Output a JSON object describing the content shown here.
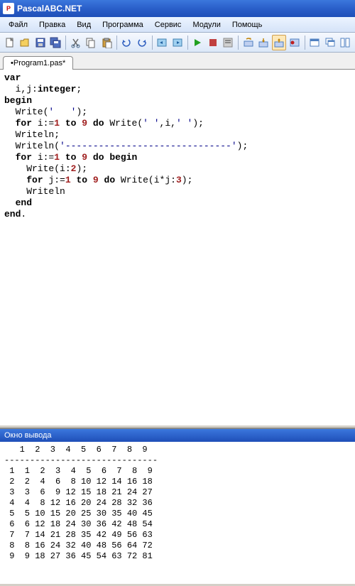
{
  "title": "PascalABC.NET",
  "menu": [
    "Файл",
    "Правка",
    "Вид",
    "Программа",
    "Сервис",
    "Модули",
    "Помощь"
  ],
  "tab": "•Program1.pas*",
  "output_title": "Окно вывода",
  "code": {
    "l1": "var",
    "l2_a": "  i,j:",
    "l2_b": "integer",
    "l2_c": ";",
    "l3": "begin",
    "l4_a": "  Write(",
    "l4_b": "'   '",
    "l4_c": ");",
    "l5_a": "  ",
    "l5_for": "for",
    "l5_b": " i:=",
    "l5_1": "1",
    "l5_c": " ",
    "l5_to": "to",
    "l5_d": " ",
    "l5_9": "9",
    "l5_e": " ",
    "l5_do": "do",
    "l5_f": " Write(",
    "l5_s1": "' '",
    "l5_g": ",i,",
    "l5_s2": "' '",
    "l5_h": ");",
    "l6": "  Writeln;",
    "l7_a": "  Writeln(",
    "l7_s": "'------------------------------'",
    "l7_b": ");",
    "l8_a": "  ",
    "l8_for": "for",
    "l8_b": " i:=",
    "l8_1": "1",
    "l8_c": " ",
    "l8_to": "to",
    "l8_d": " ",
    "l8_9": "9",
    "l8_e": " ",
    "l8_do": "do",
    "l8_f": " ",
    "l8_begin": "begin",
    "l9_a": "    Write(i:",
    "l9_2": "2",
    "l9_b": ");",
    "l10_a": "    ",
    "l10_for": "for",
    "l10_b": " j:=",
    "l10_1": "1",
    "l10_c": " ",
    "l10_to": "to",
    "l10_d": " ",
    "l10_9": "9",
    "l10_e": " ",
    "l10_do": "do",
    "l10_f": " Write(i*j:",
    "l10_3": "3",
    "l10_g": ");",
    "l11": "    Writeln",
    "l12": "  ",
    "l12_end": "end",
    "l13": "end",
    "l13_dot": "."
  },
  "output_text": "   1  2  3  4  5  6  7  8  9\n------------------------------\n 1  1  2  3  4  5  6  7  8  9\n 2  2  4  6  8 10 12 14 16 18\n 3  3  6  9 12 15 18 21 24 27\n 4  4  8 12 16 20 24 28 32 36\n 5  5 10 15 20 25 30 35 40 45\n 6  6 12 18 24 30 36 42 48 54\n 7  7 14 21 28 35 42 49 56 63\n 8  8 16 24 32 40 48 56 64 72\n 9  9 18 27 36 45 54 63 72 81"
}
